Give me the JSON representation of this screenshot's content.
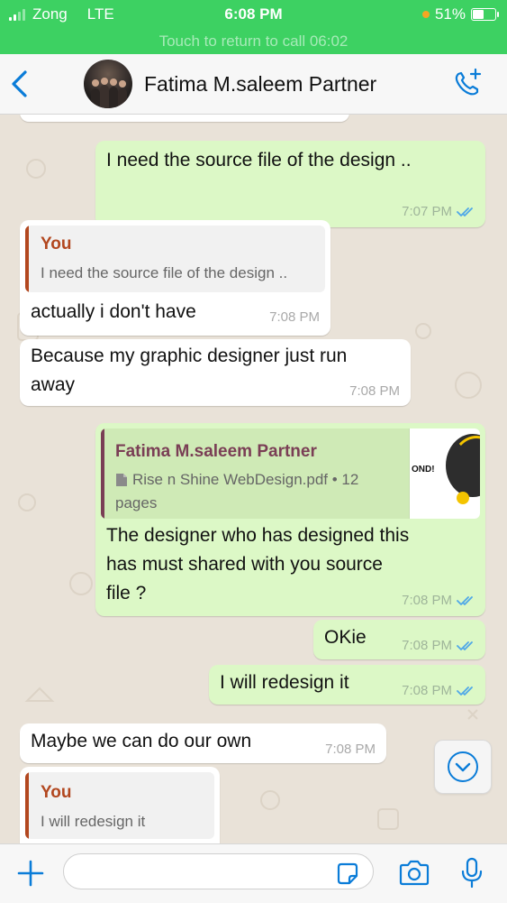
{
  "status_bar": {
    "carrier": "Zong",
    "network": "LTE",
    "time": "6:08 PM",
    "battery": "51%",
    "call_banner": "Touch to return to call 06:02"
  },
  "header": {
    "contact_name": "Fatima M.saleem Partner"
  },
  "messages": [
    {
      "text": "I need the source file of the design ..",
      "time": "7:07 PM"
    },
    {
      "quote_name": "You",
      "quote_text": "I need the source file of the design ..",
      "text": "actually i don't have",
      "time": "7:08 PM"
    },
    {
      "text_line1": "Because my graphic designer just run",
      "text_line2": "away",
      "time": "7:08 PM"
    },
    {
      "quote_name": "Fatima M.saleem Partner",
      "doc_line1": "Rise n Shine WebDesign.pdf • 12",
      "doc_line2": "pages",
      "thumb_text": "OND!",
      "text_line1": "The designer who has designed this",
      "text_line2": "has must shared with you source",
      "text_line3": "file ?",
      "time": "7:08 PM"
    },
    {
      "text": "OKie",
      "time": "7:08 PM"
    },
    {
      "text": "I will redesign it",
      "time": "7:08 PM"
    },
    {
      "text": "Maybe we can do our own",
      "time": "7:08 PM"
    },
    {
      "quote_name": "You",
      "quote_text": "I will redesign it"
    }
  ],
  "colors": {
    "status_green": "#3dd162",
    "accent_blue": "#0a7cd8",
    "quote_you": "#b2471f",
    "quote_partner": "#7a3e55",
    "read_ticks": "#4fa7e8"
  },
  "icons": [
    "back-icon",
    "call-add-icon",
    "document-icon",
    "double-check-icon",
    "chevron-down-icon",
    "plus-icon",
    "sticker-icon",
    "camera-icon",
    "microphone-icon"
  ]
}
